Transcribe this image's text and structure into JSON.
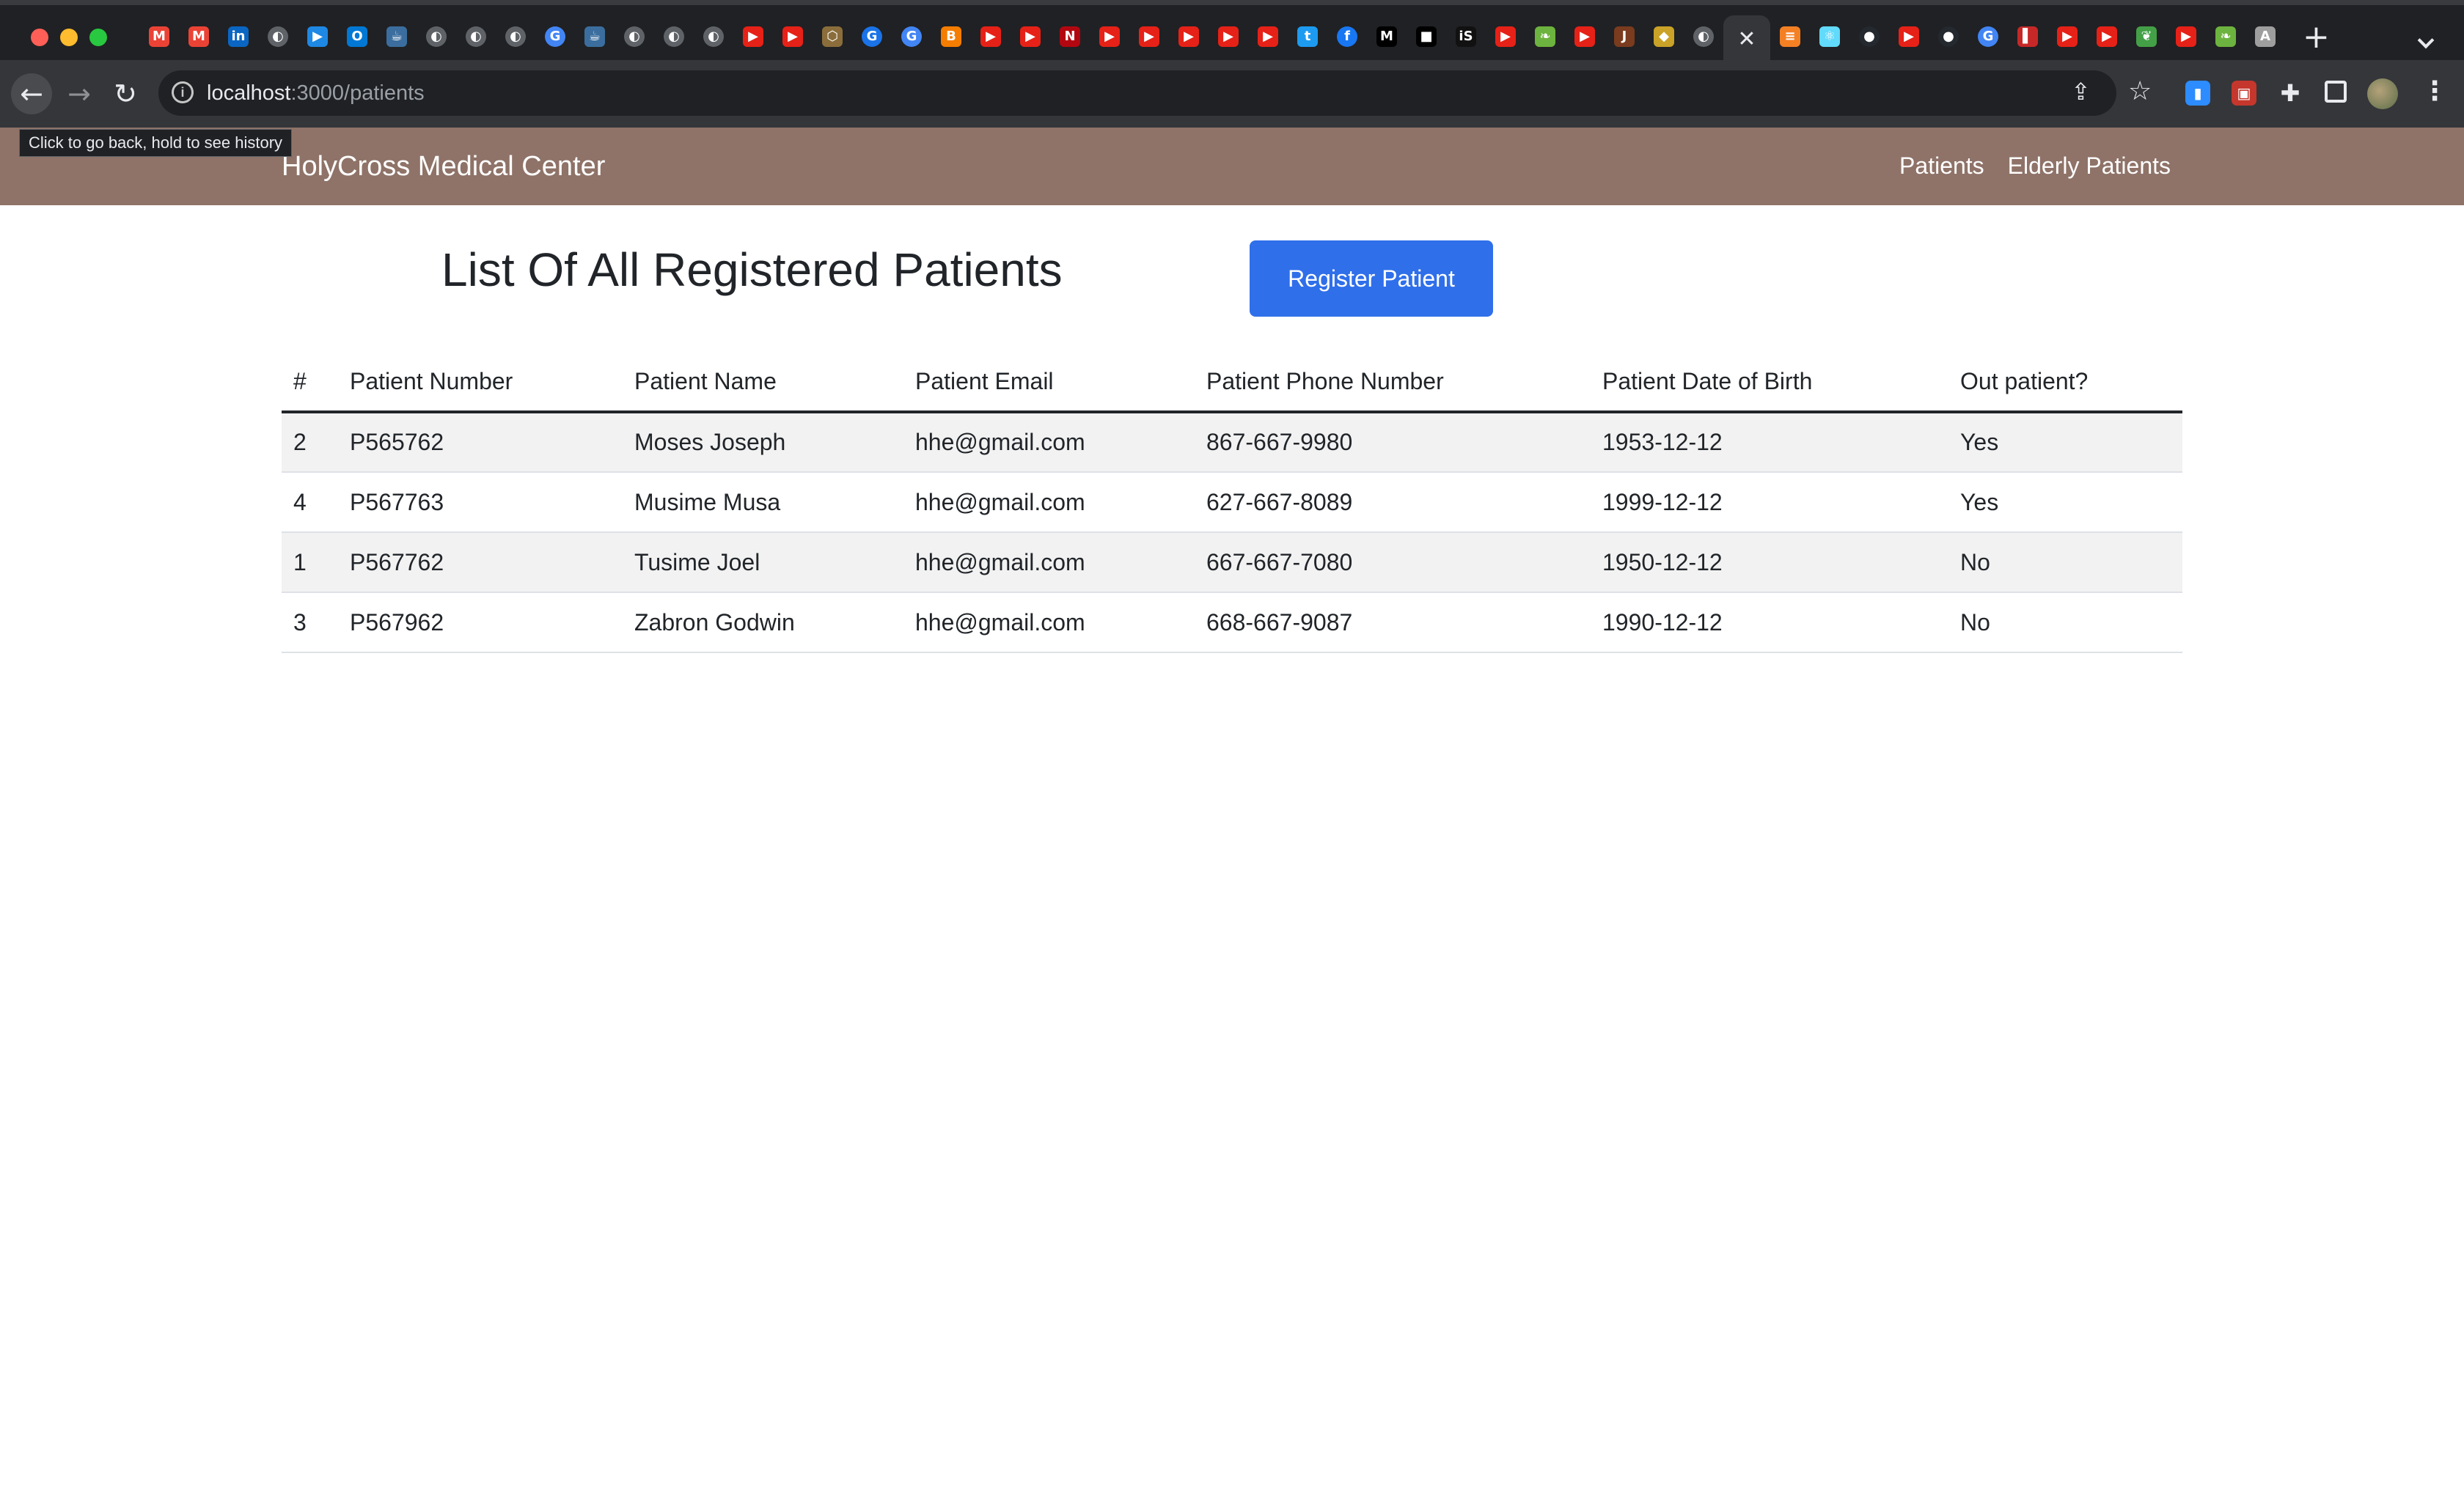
{
  "browser": {
    "tab_favicons": [
      {
        "icon": "gmail-icon",
        "glyph": "M",
        "color": "#ea4335"
      },
      {
        "icon": "gmail-icon",
        "glyph": "M",
        "color": "#ea4335"
      },
      {
        "icon": "linkedin-icon",
        "glyph": "in",
        "color": "#0a66c2"
      },
      {
        "icon": "globe-icon",
        "glyph": "◐",
        "color": "#5f6368"
      },
      {
        "icon": "video-icon",
        "glyph": "▶",
        "color": "#1e88e5"
      },
      {
        "icon": "outlook-icon",
        "glyph": "O",
        "color": "#0078d4"
      },
      {
        "icon": "java-icon",
        "glyph": "☕",
        "color": "#3b6e9e"
      },
      {
        "icon": "globe-icon",
        "glyph": "◐",
        "color": "#5f6368"
      },
      {
        "icon": "globe-icon",
        "glyph": "◐",
        "color": "#5f6368"
      },
      {
        "icon": "globe-icon",
        "glyph": "◐",
        "color": "#5f6368"
      },
      {
        "icon": "google-icon",
        "glyph": "G",
        "color": "#4285f4"
      },
      {
        "icon": "java-icon",
        "glyph": "☕",
        "color": "#3b6e9e"
      },
      {
        "icon": "globe-icon",
        "glyph": "◐",
        "color": "#5f6368"
      },
      {
        "icon": "globe-icon",
        "glyph": "◐",
        "color": "#5f6368"
      },
      {
        "icon": "globe-icon",
        "glyph": "◐",
        "color": "#5f6368"
      },
      {
        "icon": "youtube-icon",
        "glyph": "▶",
        "color": "#e62117"
      },
      {
        "icon": "youtube-icon",
        "glyph": "▶",
        "color": "#e62117"
      },
      {
        "icon": "cube-icon",
        "glyph": "⬡",
        "color": "#8a6d3b"
      },
      {
        "icon": "google-icon",
        "glyph": "G",
        "color": "#1a73e8"
      },
      {
        "icon": "google-icon",
        "glyph": "G",
        "color": "#4285f4"
      },
      {
        "icon": "blogger-icon",
        "glyph": "B",
        "color": "#f57d00"
      },
      {
        "icon": "youtube-icon",
        "glyph": "▶",
        "color": "#e62117"
      },
      {
        "icon": "youtube-icon",
        "glyph": "▶",
        "color": "#e62117"
      },
      {
        "icon": "netflix-icon",
        "glyph": "N",
        "color": "#b20710"
      },
      {
        "icon": "youtube-icon",
        "glyph": "▶",
        "color": "#e62117"
      },
      {
        "icon": "youtube-icon",
        "glyph": "▶",
        "color": "#e62117"
      },
      {
        "icon": "youtube-icon",
        "glyph": "▶",
        "color": "#e62117"
      },
      {
        "icon": "youtube-icon",
        "glyph": "▶",
        "color": "#e62117"
      },
      {
        "icon": "youtube-icon",
        "glyph": "▶",
        "color": "#e62117"
      },
      {
        "icon": "twitter-icon",
        "glyph": "t",
        "color": "#1d9bf0"
      },
      {
        "icon": "facebook-icon",
        "glyph": "f",
        "color": "#1877f2"
      },
      {
        "icon": "medium-icon",
        "glyph": "M",
        "color": "#000000"
      },
      {
        "icon": "black-square-icon",
        "glyph": "■",
        "color": "#000000"
      },
      {
        "icon": "is-icon",
        "glyph": "iS",
        "color": "#111111"
      },
      {
        "icon": "youtube-icon",
        "glyph": "▶",
        "color": "#e62117"
      },
      {
        "icon": "spring-icon",
        "glyph": "❧",
        "color": "#6db33f"
      },
      {
        "icon": "youtube-icon",
        "glyph": "▶",
        "color": "#e62117"
      },
      {
        "icon": "j-icon",
        "glyph": "J",
        "color": "#7a3b1e"
      },
      {
        "icon": "shield-icon",
        "glyph": "◆",
        "color": "#c9a227"
      },
      {
        "icon": "globe-icon",
        "glyph": "◐",
        "color": "#5f6368"
      },
      {
        "icon": "close-icon",
        "glyph": "✕",
        "color": "#35363a",
        "active": true
      },
      {
        "icon": "stackoverflow-icon",
        "glyph": "≡",
        "color": "#f48024"
      },
      {
        "icon": "react-icon",
        "glyph": "⚛",
        "color": "#61dafb"
      },
      {
        "icon": "github-icon",
        "glyph": "●",
        "color": "#24292f"
      },
      {
        "icon": "youtube-icon",
        "glyph": "▶",
        "color": "#e62117"
      },
      {
        "icon": "github-icon",
        "glyph": "●",
        "color": "#24292f"
      },
      {
        "icon": "google-icon",
        "glyph": "G",
        "color": "#4285f4"
      },
      {
        "icon": "flag-icon",
        "glyph": "▌",
        "color": "#c62828"
      },
      {
        "icon": "youtube-icon",
        "glyph": "▶",
        "color": "#e62117"
      },
      {
        "icon": "youtube-icon",
        "glyph": "▶",
        "color": "#e62117"
      },
      {
        "icon": "leaf-icon",
        "glyph": "❦",
        "color": "#43a047"
      },
      {
        "icon": "youtube-icon",
        "glyph": "▶",
        "color": "#e62117"
      },
      {
        "icon": "spring-icon",
        "glyph": "❧",
        "color": "#6db33f"
      },
      {
        "icon": "letter-a-icon",
        "glyph": "A",
        "color": "#9e9e9e"
      }
    ],
    "url_host": "localhost",
    "url_path": ":3000/patients",
    "back_tooltip": "Click to go back, hold to see history"
  },
  "navbar": {
    "brand": "HolyCross Medical Center",
    "links": [
      "Patients",
      "Elderly Patients"
    ],
    "background": "#8f7368"
  },
  "main": {
    "title": "List Of All Registered Patients",
    "register_button": "Register Patient",
    "accent_color": "#2f6fea"
  },
  "table": {
    "headers": [
      "#",
      "Patient Number",
      "Patient Name",
      "Patient Email",
      "Patient Phone Number",
      "Patient Date of Birth",
      "Out patient?"
    ],
    "rows": [
      [
        "2",
        "P565762",
        "Moses Joseph",
        "hhe@gmail.com",
        "867-667-9980",
        "1953-12-12",
        "Yes"
      ],
      [
        "4",
        "P567763",
        "Musime Musa",
        "hhe@gmail.com",
        "627-667-8089",
        "1999-12-12",
        "Yes"
      ],
      [
        "1",
        "P567762",
        "Tusime Joel",
        "hhe@gmail.com",
        "667-667-7080",
        "1950-12-12",
        "No"
      ],
      [
        "3",
        "P567962",
        "Zabron Godwin",
        "hhe@gmail.com",
        "668-667-9087",
        "1990-12-12",
        "No"
      ]
    ]
  }
}
